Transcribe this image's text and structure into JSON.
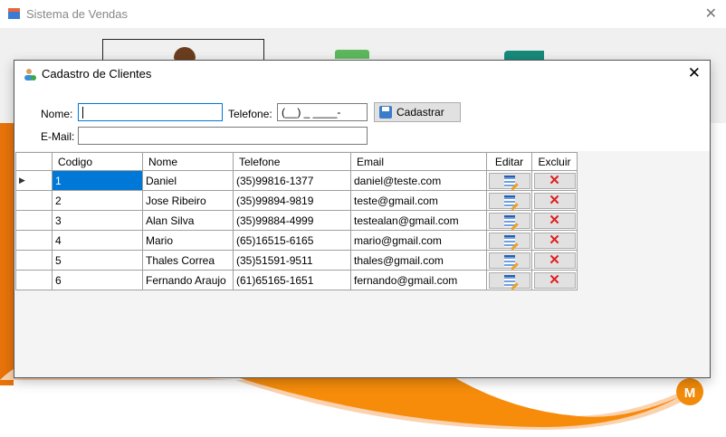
{
  "main_window": {
    "title": "Sistema de Vendas",
    "close": "✕"
  },
  "dialog": {
    "title": "Cadastro de Clientes",
    "close": "✕",
    "form": {
      "nome_label": "Nome:",
      "nome_value": "",
      "telefone_label": "Telefone:",
      "telefone_mask": "(__) _ ____-____",
      "email_label": "E-Mail:",
      "email_value": "",
      "cadastrar_label": "Cadastrar"
    },
    "grid": {
      "columns": [
        "Codigo",
        "Nome",
        "Telefone",
        "Email",
        "Editar",
        "Excluir"
      ],
      "rows": [
        {
          "codigo": "1",
          "nome": "Daniel",
          "telefone": "(35)99816-1377",
          "email": "daniel@teste.com"
        },
        {
          "codigo": "2",
          "nome": "Jose Ribeiro",
          "telefone": "(35)99894-9819",
          "email": "teste@gmail.com"
        },
        {
          "codigo": "3",
          "nome": "Alan Silva",
          "telefone": "(35)99884-4999",
          "email": "testealan@gmail.com"
        },
        {
          "codigo": "4",
          "nome": "Mario",
          "telefone": "(65)16515-6165",
          "email": "mario@gmail.com"
        },
        {
          "codigo": "5",
          "nome": "Thales Correa",
          "telefone": "(35)51591-9511",
          "email": "thales@gmail.com"
        },
        {
          "codigo": "6",
          "nome": "Fernando Araujo",
          "telefone": "(61)65165-1651",
          "email": "fernando@gmail.com"
        }
      ],
      "current_row_marker": "▶",
      "delete_glyph": "✕"
    }
  },
  "logo_letter": "M"
}
